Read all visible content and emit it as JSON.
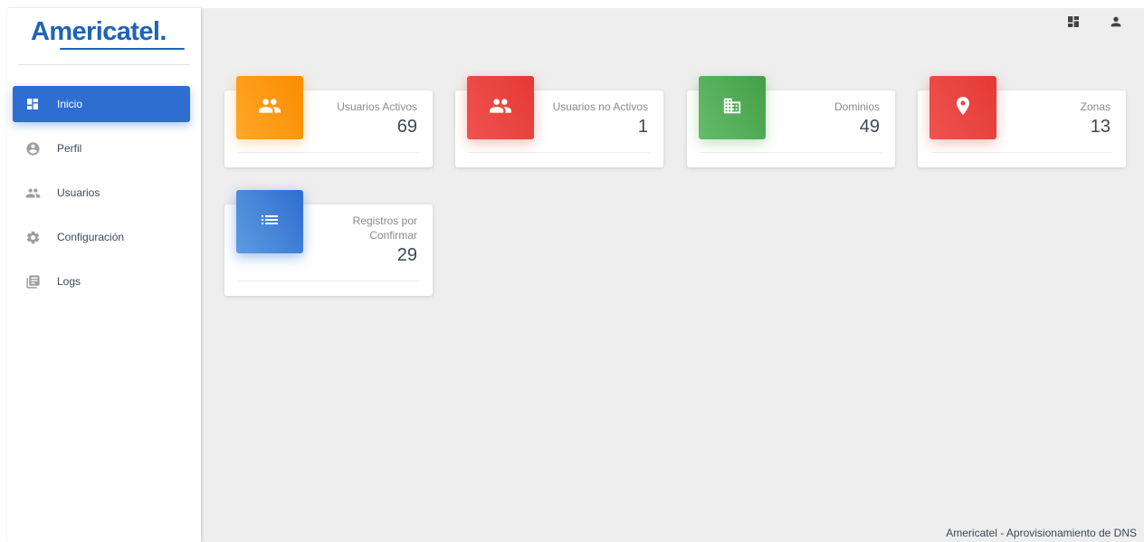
{
  "brand": {
    "logo_text": "Americatel",
    "logo_dot": ".",
    "color": "#1f63b7"
  },
  "sidebar": {
    "items": [
      {
        "label": "Inicio",
        "icon": "dashboard-icon",
        "active": true
      },
      {
        "label": "Perfil",
        "icon": "account-circle-icon",
        "active": false
      },
      {
        "label": "Usuarios",
        "icon": "people-icon",
        "active": false
      },
      {
        "label": "Configuración",
        "icon": "gear-icon",
        "active": false
      },
      {
        "label": "Logs",
        "icon": "library-books-icon",
        "active": false
      }
    ]
  },
  "topbar": {
    "icons": [
      "dashboard-icon",
      "person-icon"
    ]
  },
  "cards": [
    {
      "title": "Usuarios Activos",
      "value": "69",
      "icon": "people-icon",
      "color": "orange"
    },
    {
      "title": "Usuarios no Activos",
      "value": "1",
      "icon": "people-icon",
      "color": "red"
    },
    {
      "title": "Dominios",
      "value": "49",
      "icon": "building-icon",
      "color": "green"
    },
    {
      "title": "Zonas",
      "value": "13",
      "icon": "location-pin-icon",
      "color": "red"
    },
    {
      "title": "Registros por Confirmar",
      "value": "29",
      "icon": "list-icon",
      "color": "blue"
    }
  ],
  "colors": {
    "accent": "#2d6ed0",
    "orange": "#fb8c00",
    "red": "#e53935",
    "green": "#43a047",
    "background": "#eeeeee"
  },
  "footer": {
    "text": "Americatel - Aprovisionamiento de DNS"
  }
}
